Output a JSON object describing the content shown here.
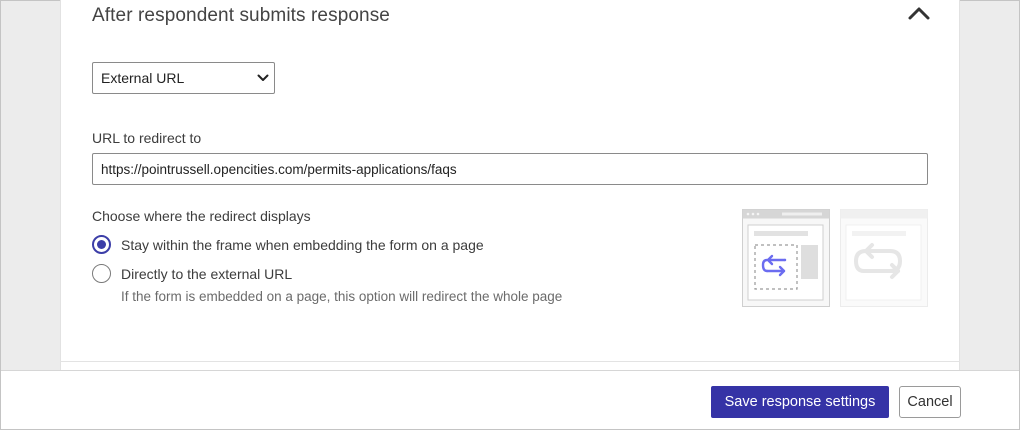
{
  "section": {
    "title": "After respondent submits response",
    "collapse_icon": "chevron-up-icon"
  },
  "destination_select": {
    "selected": "External URL",
    "icon": "chevron-down-icon"
  },
  "redirect_url": {
    "label": "URL to redirect to",
    "value": "https://pointrussell.opencities.com/permits-applications/faqs"
  },
  "redirect_display": {
    "label": "Choose where the redirect displays",
    "options": [
      {
        "label": "Stay within the frame when embedding the form on a page",
        "checked": true
      },
      {
        "label": "Directly to the external URL",
        "checked": false
      }
    ],
    "hint": "If the form is embedded on a page, this option will redirect the whole page"
  },
  "colors": {
    "accent": "#3533a6",
    "illustration_accent": "#6b6cf0"
  },
  "footer": {
    "save_label": "Save response settings",
    "cancel_label": "Cancel"
  }
}
